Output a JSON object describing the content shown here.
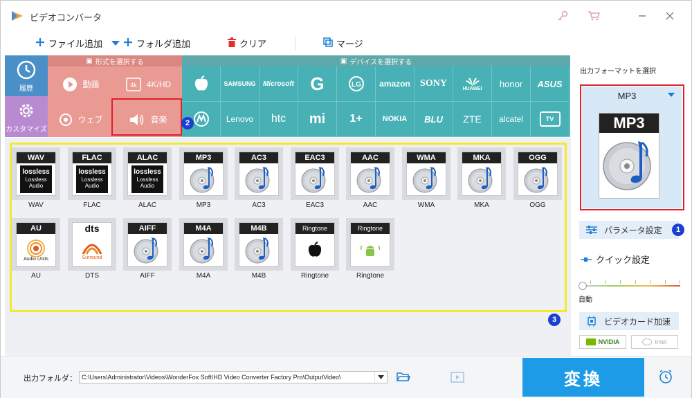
{
  "window": {
    "title": "ビデオコンバータ"
  },
  "toolbar": {
    "add_file": "ファイル追加",
    "add_folder": "フォルダ追加",
    "clear": "クリア",
    "merge": "マージ"
  },
  "left_bar": {
    "history": "履歴",
    "custom": "カスタマイズ"
  },
  "format_section": {
    "header": "形式を選択する",
    "items": [
      "動画",
      "4K/HD",
      "ウェブ",
      "音楽"
    ],
    "selected": "音楽"
  },
  "device_section": {
    "header": "デバイスを選択する",
    "row1": [
      "",
      "SAMSUNG",
      "Microsoft",
      "G",
      "LG",
      "amazon",
      "SONY",
      "HUAWEI",
      "honor",
      "ASUS"
    ],
    "row2": [
      "M",
      "Lenovo",
      "htc",
      "mi",
      "1+",
      "NOKIA",
      "BLU",
      "ZTE",
      "alcatel",
      "TV"
    ]
  },
  "formats": [
    {
      "tag": "WAV",
      "name": "WAV",
      "kind": "lossless"
    },
    {
      "tag": "FLAC",
      "name": "FLAC",
      "kind": "lossless"
    },
    {
      "tag": "ALAC",
      "name": "ALAC",
      "kind": "lossless"
    },
    {
      "tag": "MP3",
      "name": "MP3",
      "kind": "disc"
    },
    {
      "tag": "AC3",
      "name": "AC3",
      "kind": "disc"
    },
    {
      "tag": "EAC3",
      "name": "EAC3",
      "kind": "disc"
    },
    {
      "tag": "AAC",
      "name": "AAC",
      "kind": "disc"
    },
    {
      "tag": "WMA",
      "name": "WMA",
      "kind": "disc"
    },
    {
      "tag": "MKA",
      "name": "MKA",
      "kind": "disc"
    },
    {
      "tag": "OGG",
      "name": "OGG",
      "kind": "disc"
    },
    {
      "tag": "AU",
      "name": "AU",
      "kind": "au"
    },
    {
      "tag": "dts",
      "name": "DTS",
      "kind": "dts"
    },
    {
      "tag": "AIFF",
      "name": "AIFF",
      "kind": "disc"
    },
    {
      "tag": "M4A",
      "name": "M4A",
      "kind": "disc"
    },
    {
      "tag": "M4B",
      "name": "M4B",
      "kind": "disc"
    },
    {
      "tag": "Ringtone",
      "name": "Ringtone",
      "kind": "apple"
    },
    {
      "tag": "Ringtone",
      "name": "Ringtone",
      "kind": "android"
    }
  ],
  "lossless_text": {
    "brand": "lossless",
    "line1": "Lossless",
    "line2": "Audio"
  },
  "au_text": "Audio Units",
  "dts_text": "Surround",
  "right_panel": {
    "title": "出力フォーマットを選択",
    "selected_format": "MP3",
    "big_tag": "MP3",
    "param_button": "パラメータ設定",
    "quick_setting": "クイック設定",
    "auto_label": "自動",
    "gpu_button": "ビデオカード加速",
    "nvidia": "NVIDIA",
    "intel": "Intel"
  },
  "badges": {
    "b1": "1",
    "b2": "2",
    "b3": "3"
  },
  "bottom": {
    "output_label": "出力フォルダ：",
    "output_path": "C:\\Users\\Administrator\\Videos\\WonderFox Soft\\HD Video Converter Factory Pro\\OutputVideo\\",
    "convert": "変換"
  },
  "colors": {
    "accent": "#1e9be6",
    "format_panel": "#e99a93",
    "device_panel": "#47b1b6",
    "highlight_red": "#e0202a",
    "highlight_yellow": "#f1ea31"
  }
}
